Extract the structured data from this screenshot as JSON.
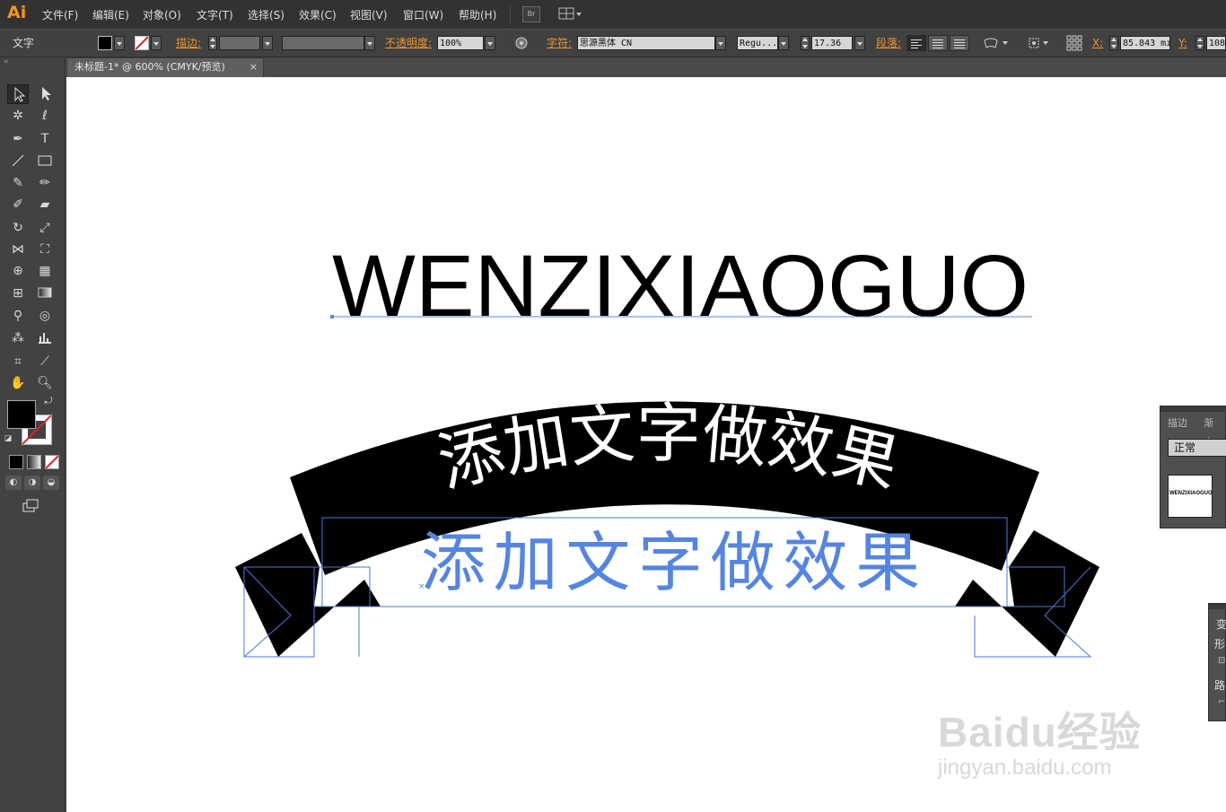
{
  "app": {
    "logo": "Ai"
  },
  "menu": [
    "文件(F)",
    "编辑(E)",
    "对象(O)",
    "文字(T)",
    "选择(S)",
    "效果(C)",
    "视图(V)",
    "窗口(W)",
    "帮助(H)"
  ],
  "menubar_buttons": {
    "bridge": "Br"
  },
  "control": {
    "mode_label": "文字",
    "stroke_label": "描边:",
    "opacity_label": "不透明度:",
    "opacity_value": "100%",
    "character_label": "字符:",
    "font_value": "思源黑体 CN",
    "style_value": "Regu...",
    "size_value": "17.36",
    "paragraph_label": "段落:",
    "x_label": "X:",
    "x_value": "85.843 mı",
    "y_label": "Y:",
    "y_value": "108"
  },
  "document": {
    "tab_title": "未标题-1* @ 600% (CMYK/预览)",
    "close": "×"
  },
  "artwork": {
    "heading": "WENZIXIAOGUO",
    "banner_text": "添加文字做效果",
    "selected_text": "添加文字做效果",
    "banner_color": "#000000",
    "selected_text_color": "#5585e0",
    "selection_color": "#4a78d8"
  },
  "panels": {
    "transparency": {
      "tab1": "描边",
      "tab2": "渐变",
      "blend_mode": "正常",
      "thumbnail_text": "WENZIXIAOGUO"
    },
    "transform": {
      "tab": "变",
      "row1": "形",
      "row2": "路"
    }
  },
  "watermark": {
    "line1": "Baidu经验",
    "line2": "jingyan.baidu.com"
  }
}
